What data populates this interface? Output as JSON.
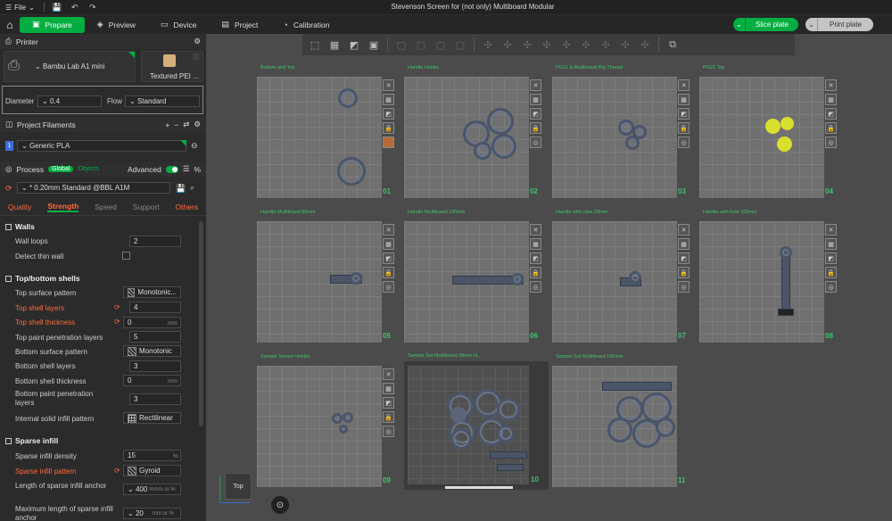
{
  "titlebar": {
    "file": "File",
    "title": "Stevenson Screen for (not only) Multiboard Modular"
  },
  "menubar": {
    "tabs": [
      {
        "label": "Prepare",
        "icon": "box-icon"
      },
      {
        "label": "Preview",
        "icon": "layers-icon"
      },
      {
        "label": "Device",
        "icon": "monitor-icon"
      },
      {
        "label": "Project",
        "icon": "document-icon"
      },
      {
        "label": "Calibration",
        "icon": "gauge-icon"
      }
    ],
    "slice": "Slice plate",
    "print": "Print plate"
  },
  "printer": {
    "section": "Printer",
    "name": "Bambu Lab A1 mini",
    "plate": "Textured PEI ...",
    "diameter_label": "Diameter",
    "diameter": "0.4",
    "flow_label": "Flow",
    "flow": "Standard"
  },
  "filaments": {
    "section": "Project Filaments",
    "index": "1",
    "name": "Generic PLA"
  },
  "process": {
    "section": "Process",
    "global": "Global",
    "objects": "Objects",
    "advanced": "Advanced",
    "profile": "* 0.20mm Standard @BBL A1M",
    "tabs": [
      "Quality",
      "Strength",
      "Speed",
      "Support",
      "Others"
    ]
  },
  "walls": {
    "title": "Walls",
    "wall_loops_label": "Wall loops",
    "wall_loops": "2",
    "detect_thin_label": "Detect thin wall"
  },
  "shells": {
    "title": "Top/bottom shells",
    "top_pattern_label": "Top surface pattern",
    "top_pattern": "Monotonic...",
    "top_layers_label": "Top shell layers",
    "top_layers": "4",
    "top_thickness_label": "Top shell thickness",
    "top_thickness": "0",
    "mm": "mm",
    "top_paint_label": "Top paint penetration layers",
    "top_paint": "5",
    "bottom_pattern_label": "Bottom surface pattern",
    "bottom_pattern": "Monotonic",
    "bottom_layers_label": "Bottom shell layers",
    "bottom_layers": "3",
    "bottom_thickness_label": "Bottom shell thickness",
    "bottom_thickness": "0",
    "bottom_paint_label": "Bottom paint penetration layers",
    "bottom_paint": "3",
    "internal_label": "Internal solid infill pattern",
    "internal": "Rectilinear"
  },
  "sparse": {
    "title": "Sparse infill",
    "density_label": "Sparse infill density",
    "density": "15",
    "percent": "%",
    "pattern_label": "Sparse infill pattern",
    "pattern": "Gyroid",
    "length_label": "Length of sparse infill anchor",
    "length": "400",
    "length_unit": "%mm or %",
    "max_label": "Maximum length of sparse infill anchor",
    "max": "20",
    "max_unit": "mm or %"
  },
  "plates": [
    {
      "title": "Bottom and Top",
      "num": "01"
    },
    {
      "title": "Handle Holder",
      "num": "02"
    },
    {
      "title": "PG21 & Multiboard Big Thread",
      "num": "03"
    },
    {
      "title": "PG21 Top",
      "num": "04"
    },
    {
      "title": "Handle Multiboard 80mm",
      "num": "05"
    },
    {
      "title": "Handle Multiboard 100mm",
      "num": "06"
    },
    {
      "title": "Handle with clips 20mm",
      "num": "07"
    },
    {
      "title": "Handle with hole 100mm",
      "num": "08"
    },
    {
      "title": "Sample Sensor Holder",
      "num": "09"
    },
    {
      "title": "Sample Set Multiboard 38mm H...",
      "num": "10"
    },
    {
      "title": "Sample Set Multiboard 180mm",
      "num": "11"
    }
  ],
  "viewcube": {
    "face": "Top"
  },
  "colors": {
    "accent": "#00ae42",
    "warning": "#ff6a3d",
    "canvas": "#4b4b4b"
  }
}
